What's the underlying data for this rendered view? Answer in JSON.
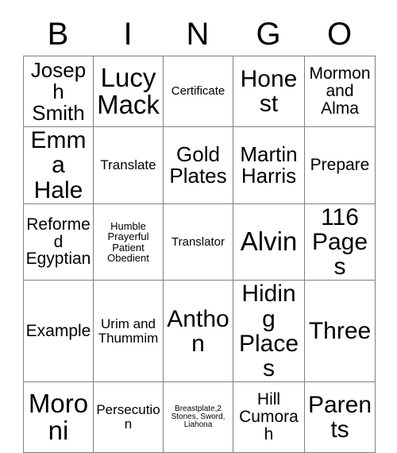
{
  "card": {
    "title": "Bingo Card",
    "header_letters": [
      "B",
      "I",
      "N",
      "G",
      "O"
    ],
    "grid_size": "5x5",
    "colors": {
      "background": "#ffffff",
      "text": "#000000",
      "grid_line": "#808080"
    },
    "rows": [
      {
        "cells": [
          {
            "text": "Joseph Smith",
            "size": "lg"
          },
          {
            "text": "Lucy Mack",
            "size": "xxl"
          },
          {
            "text": "Certificate",
            "size": "xs"
          },
          {
            "text": "Honest",
            "size": "xl"
          },
          {
            "text": "Mormon and Alma",
            "size": "md"
          }
        ]
      },
      {
        "cells": [
          {
            "text": "Emma Hale",
            "size": "xl"
          },
          {
            "text": "Translate",
            "size": "sm"
          },
          {
            "text": "Gold Plates",
            "size": "lg"
          },
          {
            "text": "Martin Harris",
            "size": "lg"
          },
          {
            "text": "Prepare",
            "size": "md"
          }
        ]
      },
      {
        "cells": [
          {
            "text": "Reformed Egyptian",
            "size": "md"
          },
          {
            "text": "Humble Prayerful Patient Obedient",
            "size": "xxs"
          },
          {
            "text": "Translator",
            "size": "xs"
          },
          {
            "text": "Alvin",
            "size": "xxl"
          },
          {
            "text": "116 Pages",
            "size": "xl"
          }
        ]
      },
      {
        "cells": [
          {
            "text": "Example",
            "size": "md"
          },
          {
            "text": "Urim and Thummim",
            "size": "sm"
          },
          {
            "text": "Anthon",
            "size": "xl"
          },
          {
            "text": "Hiding Places",
            "size": "xl"
          },
          {
            "text": "Three",
            "size": "xl"
          }
        ]
      },
      {
        "cells": [
          {
            "text": "Moroni",
            "size": "xxl"
          },
          {
            "text": "Persecution",
            "size": "sm"
          },
          {
            "text": "Breastplate,2 Stones, Sword, Liahona",
            "size": "tiny"
          },
          {
            "text": "Hill Cumorah",
            "size": "md"
          },
          {
            "text": "Parents",
            "size": "xl"
          }
        ]
      }
    ]
  }
}
